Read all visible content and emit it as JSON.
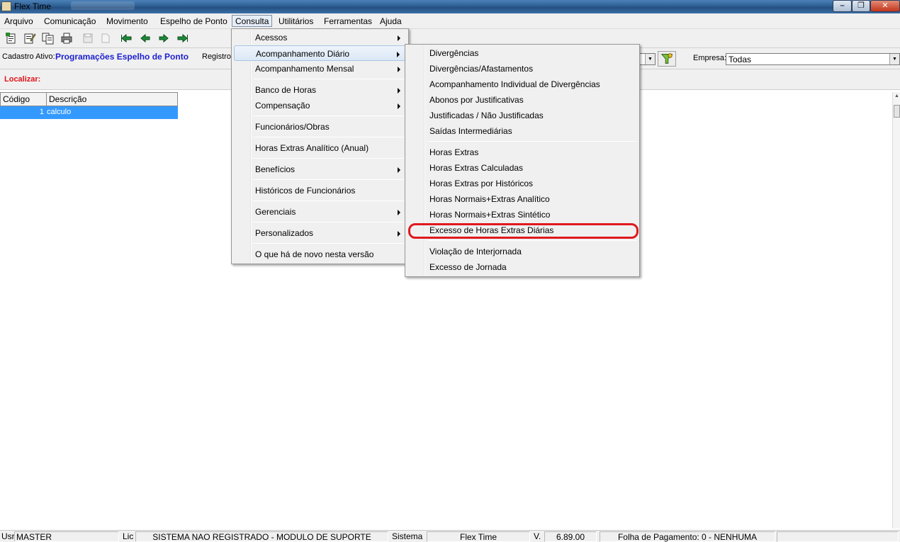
{
  "window": {
    "title": "Flex Time"
  },
  "menubar": [
    "Arquivo",
    "Comunicação",
    "Movimento",
    "Espelho de Ponto",
    "Consulta",
    "Utilitários",
    "Ferramentas",
    "Ajuda"
  ],
  "toolbar": {
    "buttons": [
      "new-record-icon",
      "edit-record-icon",
      "copy-record-icon",
      "print-icon",
      "save-icon",
      "cancel-icon",
      "first-record-icon",
      "prev-record-icon",
      "next-record-icon",
      "last-record-icon"
    ]
  },
  "info": {
    "cadastro_label": "Cadastro Ativo:",
    "cadastro_value": "Programações Espelho de Ponto",
    "registro_label": "Registro",
    "empresa_label": "Empresa:",
    "empresa_value": "Todas"
  },
  "localizar": {
    "label": "Localizar:"
  },
  "grid": {
    "columns": [
      "Código",
      "Descrição"
    ],
    "rows": [
      {
        "codigo": "1",
        "descricao": "calculo"
      }
    ]
  },
  "consulta_menu": {
    "items": [
      "Acessos",
      "Acompanhamento Diário",
      "Acompanhamento Mensal",
      "Banco de Horas",
      "Compensação",
      "Funcionários/Obras",
      "Horas Extras Analítico (Anual)",
      "Benefícios",
      "Históricos de Funcionários",
      "Gerenciais",
      "Personalizados",
      "O que há de novo nesta versão"
    ]
  },
  "submenu": {
    "items": [
      "Divergências",
      "Divergências/Afastamentos",
      "Acompanhamento Individual de Divergências",
      "Abonos por Justificativas",
      "Justificadas / Não Justificadas",
      "Saídas Intermediárias",
      "Horas Extras",
      "Horas Extras Calculadas",
      "Horas Extras por Históricos",
      "Horas Normais+Extras Analítico",
      "Horas Normais+Extras Sintético",
      "Excesso de Horas Extras Diárias",
      "Violação de Interjornada",
      "Excesso de Jornada"
    ],
    "highlighted": "Excesso de Horas Extras Diárias",
    "highlight_color": "#e0181e"
  },
  "status": {
    "usr_label": "Usr",
    "usr_value": "MASTER",
    "lic_label": "Lic",
    "lic_value": "SISTEMA NAO REGISTRADO - MODULO DE SUPORTE",
    "sistema_label": "Sistema",
    "sistema_value": "Flex Time",
    "version_label": "V.",
    "version_value": "6.89.00",
    "folha": "Folha de Pagamento: 0 - NENHUMA"
  }
}
